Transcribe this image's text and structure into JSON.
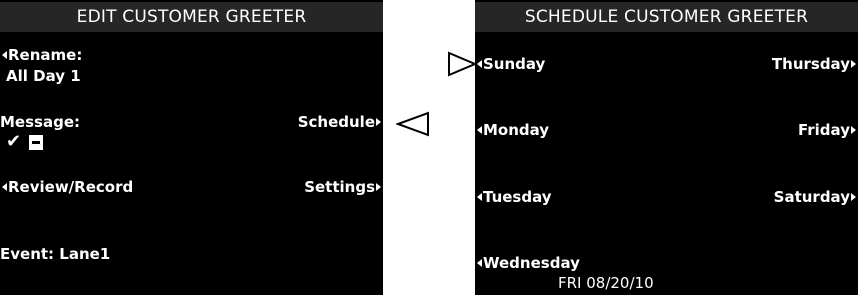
{
  "left_screen": {
    "title": "EDIT CUSTOMER GREETER",
    "rename_label": "Rename:",
    "rename_value": "All Day 1",
    "message_label": "Message:",
    "message_enabled_mark": "✔",
    "schedule_label": "Schedule",
    "review_record_label": "Review/Record",
    "settings_label": "Settings",
    "event_text": "Event: Lane1"
  },
  "right_screen": {
    "title": "SCHEDULE CUSTOMER GREETER",
    "days_left": [
      "Sunday",
      "Monday",
      "Tuesday",
      "Wednesday"
    ],
    "days_right": [
      "Thursday",
      "Friday",
      "Saturday"
    ],
    "date_text": "FRI 08/20/10"
  },
  "pointers": {
    "schedule_pointer_icon": "triangle-left-outline-icon",
    "sunday_pointer_icon": "triangle-right-outline-icon"
  }
}
